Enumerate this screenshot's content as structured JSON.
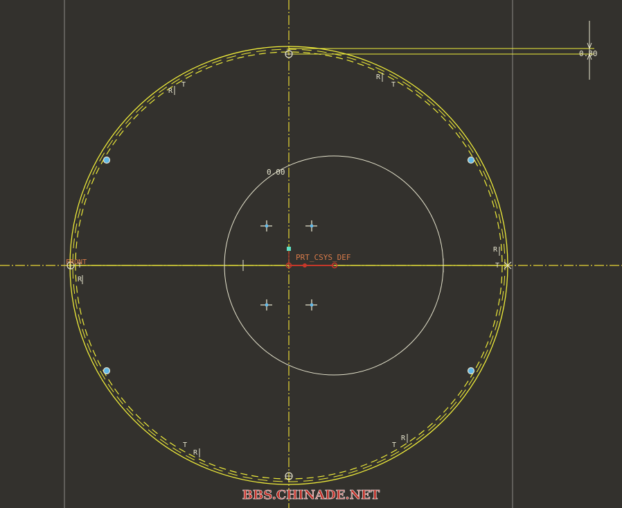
{
  "colors": {
    "background": "#33312d",
    "sketch": "#f2ef3a",
    "centerline": "#e9d835",
    "construction": "#e8e6cf",
    "frame_line": "#8e8c86",
    "point_marker": "#60b8e8",
    "csys": "#c7382a",
    "csys_label": "#d87b4a",
    "watermark": "#c03028"
  },
  "labels": {
    "dim_top": "0.80",
    "dim_inner": "0.00",
    "csys": "PRT_CSYS_DEF",
    "front": "FRONT",
    "constraint_r": "R",
    "constraint_t": "T"
  },
  "watermark": "BBS.CHINADE.NET"
}
